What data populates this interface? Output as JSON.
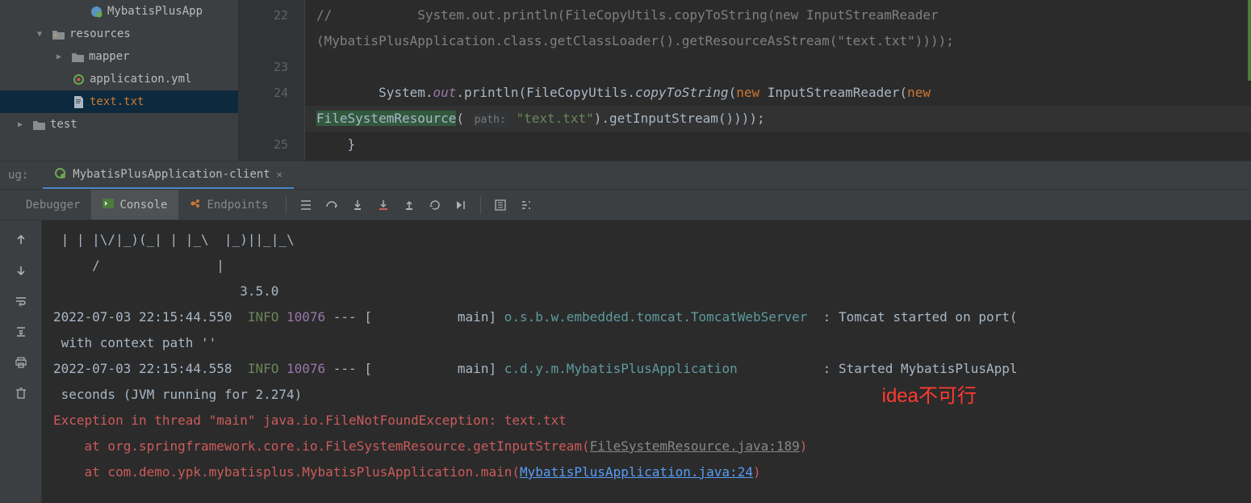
{
  "tree": {
    "item0": "MybatisPlusApp",
    "item1": "resources",
    "item2": "mapper",
    "item3": "application.yml",
    "item4": "text.txt",
    "item5": "test"
  },
  "gutter": {
    "l22": "22",
    "l23": "23",
    "l24": "24",
    "l25": "25"
  },
  "code": {
    "c22a": "//           System.out.println(FileCopyUtils.copyToString(new InputStreamReader",
    "c22b": "(MybatisPlusApplication.class.getClassLoader().getResourceAsStream(\"text.txt\"))));",
    "c24_a": "        System.",
    "c24_out": "out",
    "c24_b": ".println(FileCopyUtils.",
    "c24_copy": "copyToString",
    "c24_c": "(",
    "c24_new1": "new",
    "c24_d": " InputStreamReader(",
    "c24_new2": "new",
    "c24_e": " ",
    "c24f_a": "FileSystemResource",
    "c24f_b": "( ",
    "c24f_hint": "path:",
    "c24f_c": " ",
    "c24f_str": "\"text.txt\"",
    "c24f_d": ").getInputStream())));",
    "c25": "    }"
  },
  "debug": {
    "label": "ug:",
    "tabName": "MybatisPlusApplication-client"
  },
  "tooltabs": {
    "debugger": "Debugger",
    "console": "Console",
    "endpoints": "Endpoints"
  },
  "console": {
    "ascii1": " | | |\\/|_)(_| | |_\\  |_)||_|_\\",
    "ascii2": "     /               |",
    "ascii3": "                        3.5.0",
    "log1_ts": "2022-07-03 22:15:44.550  ",
    "log1_info": "INFO",
    "log1_pid": " 10076",
    "log1_mid": " --- [           main] ",
    "log1_logger": "o.s.b.w.embedded.tomcat.TomcatWebServer",
    "log1_sep": "  : ",
    "log1_msg": "Tomcat started on port(",
    "log1b": " with context path ''",
    "log2_ts": "2022-07-03 22:15:44.558  ",
    "log2_info": "INFO",
    "log2_pid": " 10076",
    "log2_mid": " --- [           main] ",
    "log2_logger": "c.d.y.m.MybatisPlusApplication",
    "log2_sep": "           : ",
    "log2_msg": "Started MybatisPlusAppl",
    "log2b": " seconds (JVM running for 2.274)",
    "err1": "Exception in thread \"main\" java.io.FileNotFoundException: text.txt",
    "err2a": "    at org.springframework.core.io.FileSystemResource.getInputStream(",
    "err2b": "FileSystemResource.java:189",
    "err2c": ")",
    "err3a": "    at com.demo.ypk.mybatisplus.MybatisPlusApplication.main(",
    "err3b": "MybatisPlusApplication.java:24",
    "err3c": ")"
  },
  "annotation": "idea不可行"
}
